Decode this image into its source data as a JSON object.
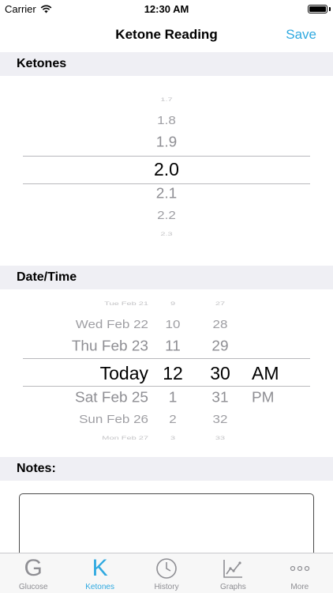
{
  "status_bar": {
    "carrier": "Carrier",
    "time": "12:30 AM",
    "battery_level": 1.0
  },
  "nav": {
    "title": "Ketone Reading",
    "save_label": "Save"
  },
  "sections": {
    "ketones": "Ketones",
    "datetime": "Date/Time",
    "notes": "Notes:"
  },
  "ketone_picker": {
    "items": [
      "1.7",
      "1.8",
      "1.9",
      "2.0",
      "2.1",
      "2.2",
      "2.3"
    ],
    "selected": "2.0"
  },
  "date_picker": {
    "dates": [
      "Tue Feb 21",
      "Wed Feb 22",
      "Thu Feb 23",
      "Today",
      "Sat Feb 25",
      "Sun Feb 26",
      "Mon Feb 27"
    ],
    "hours": [
      "9",
      "10",
      "11",
      "12",
      "1",
      "2",
      "3"
    ],
    "minutes": [
      "27",
      "28",
      "29",
      "30",
      "31",
      "32",
      "33"
    ],
    "ampm": [
      "AM",
      "PM"
    ],
    "selected": {
      "date": "Today",
      "hour": "12",
      "minute": "30",
      "ampm": "AM"
    }
  },
  "notes": {
    "value": ""
  },
  "tab_bar": {
    "active": "Ketones",
    "tabs": [
      {
        "label": "Glucose",
        "icon": "glucose-letter-g-icon",
        "glyph": "G"
      },
      {
        "label": "Ketones",
        "icon": "ketones-letter-k-icon",
        "glyph": "K"
      },
      {
        "label": "History",
        "icon": "clock-icon"
      },
      {
        "label": "Graphs",
        "icon": "line-graph-icon"
      },
      {
        "label": "More",
        "icon": "more-dots-icon"
      }
    ]
  },
  "colors": {
    "accent": "#2fa9e0",
    "section_bg": "#efeff4",
    "inactive": "#8e8e93"
  }
}
